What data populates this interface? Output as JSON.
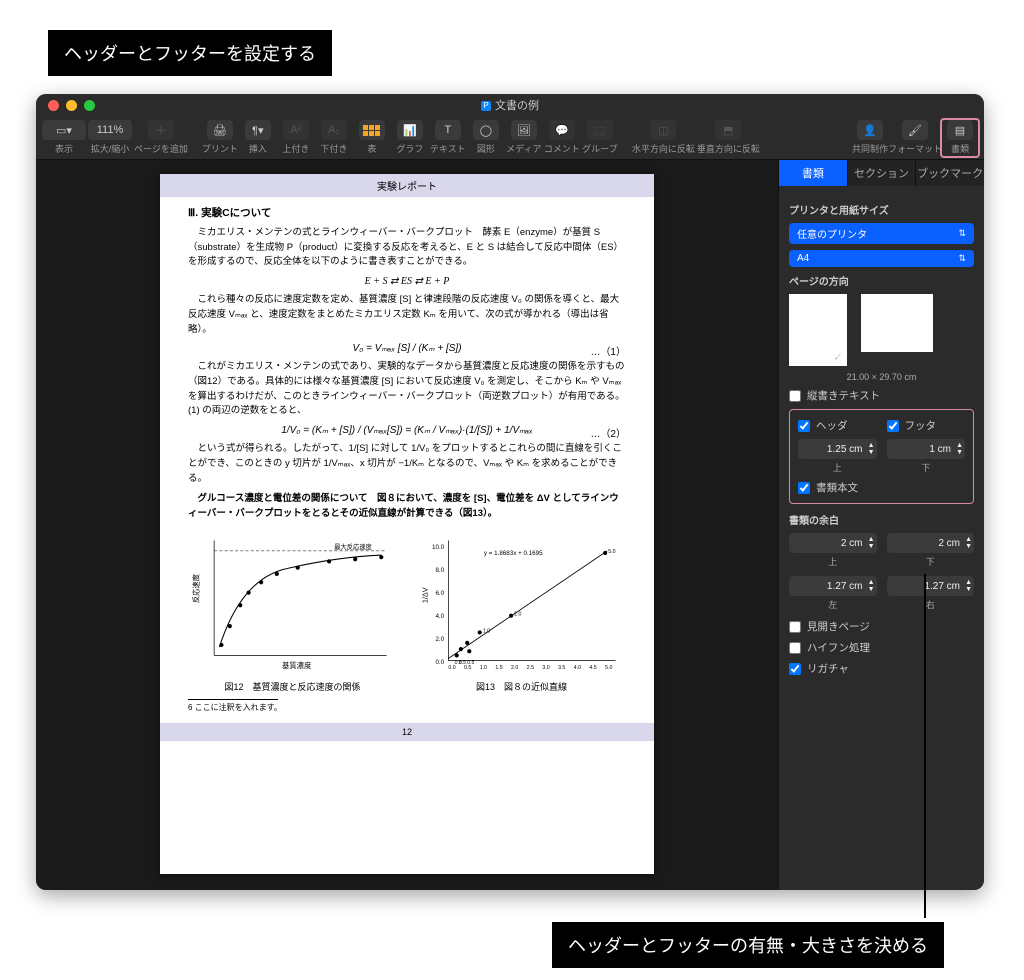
{
  "annotations": {
    "top": "ヘッダーとフッターを設定する",
    "bottom": "ヘッダーとフッターの有無・大きさを決める"
  },
  "window": {
    "title": "文書の例"
  },
  "toolbar": {
    "view": "表示",
    "zoom": "拡大/縮小",
    "zoom_value": "111%",
    "add_page": "ページを追加",
    "print": "プリント",
    "insert": "挿入",
    "superscript": "上付き",
    "subscript": "下付き",
    "table": "表",
    "chart": "グラフ",
    "text": "テキスト",
    "shape": "図形",
    "media": "メディア",
    "comment": "コメント",
    "group": "グループ",
    "flip_h": "水平方向に反転",
    "flip_v": "垂直方向に反転",
    "collab": "共同制作",
    "format": "フォーマット",
    "document": "書類"
  },
  "tabs": {
    "document": "書類",
    "section": "セクション",
    "bookmark": "ブックマーク"
  },
  "inspector": {
    "printer_title": "プリンタと用紙サイズ",
    "printer": "任意のプリンタ",
    "paper": "A4",
    "orientation_title": "ページの方向",
    "dimensions": "21.00 × 29.70 cm",
    "vertical_text": "縦書きテキスト",
    "header": "ヘッダ",
    "footer": "フッタ",
    "header_val": "1.25 cm",
    "footer_val": "1 cm",
    "top_lbl": "上",
    "bottom_lbl": "下",
    "body_text": "書類本文",
    "margins_title": "書類の余白",
    "m_top": "2 cm",
    "m_top_lbl": "上",
    "m_bottom": "2 cm",
    "m_bottom_lbl": "下",
    "m_left": "1.27 cm",
    "m_left_lbl": "左",
    "m_right": "1.27 cm",
    "m_right_lbl": "右",
    "facing": "見開きページ",
    "hyphen": "ハイフン処理",
    "ligature": "リガチャ"
  },
  "doc": {
    "header": "実験レポート",
    "h3": "Ⅲ. 実験Cについて",
    "p1": "ミカエリス・メンテンの式とラインウィーバー・バークプロット　酵素 E（enzyme）が基質 S（substrate）を生成物 P（product）に変換する反応を考えると、E と S は結合して反応中間体（ES）を形成するので、反応全体を以下のように書き表すことができる。",
    "eq1": "E + S ⇄ ES ⇄ E + P",
    "p2": "これら種々の反応に速度定数を定め、基質濃度 [S] と律速段階の反応速度 V₀ の関係を導くと、最大反応速度 Vₘₐₓ と、速度定数をまとめたミカエリス定数 Kₘ を用いて、次の式が導かれる（導出は省略）。",
    "eq2": "V₀ = Vₘₐₓ [S] / (Kₘ + [S])",
    "eq2n": "…（1）",
    "p3": "これがミカエリス・メンテンの式であり、実験的なデータから基質濃度と反応速度の関係を示すもの（図12）である。具体的には様々な基質濃度 [S] において反応速度 V₀ を測定し、そこから Kₘ や Vₘₐₓ を算出するわけだが、このときラインウィーバー・バークプロット（両逆数プロット）が有用である。(1) の両辺の逆数をとると、",
    "eq3": "1/V₀ = (Kₘ + [S]) / (Vₘₐₓ[S]) = (Kₘ / Vₘₐₓ)·(1/[S]) + 1/Vₘₐₓ",
    "eq3n": "…（2）",
    "p4": "という式が得られる。したがって、1/[S] に対して 1/V₀ をプロットするとこれらの間に直線を引くことができ、このときの y 切片が 1/Vₘₐₓ、x 切片が −1/Kₘ となるので、Vₘₐₓ や Kₘ を求めることができる。",
    "p5": "グルコース濃度と電位差の関係について　図８において、濃度を [S]、電位差を ΔV としてラインウィーバー・バークプロットをとるとその近似直線が計算できる（図13）。",
    "regress": "y = 1.8683x + 0.1695",
    "fig12": "図12　基質濃度と反応速度の関係",
    "fig12_y": "反応速度",
    "fig12_x": "基質濃度",
    "fig12_note": "最大反応速度",
    "fig13": "図13　図８の近似直線",
    "fig13_y": "1/ΔV",
    "footnote": "6 ここに注釈を入れます。",
    "page_num": "12"
  },
  "chart_data": [
    {
      "type": "scatter",
      "id": "fig12",
      "title": "図12 基質濃度と反応速度の関係",
      "xlabel": "基質濃度",
      "ylabel": "反応速度",
      "annotations": [
        "最大反応速度"
      ],
      "x": [
        0.3,
        0.6,
        1.0,
        1.3,
        1.8,
        2.5,
        3.4,
        5.0,
        7.0,
        9.0
      ],
      "y": [
        0.8,
        1.8,
        2.6,
        3.0,
        3.3,
        3.6,
        3.8,
        3.9,
        4.0,
        4.0
      ],
      "asymptote_y": 4.2
    },
    {
      "type": "scatter",
      "id": "fig13",
      "title": "図13 図８の近似直線",
      "xlabel": "",
      "ylabel": "1/ΔV",
      "xlim": [
        0.0,
        5.0
      ],
      "ylim": [
        0.0,
        10.0
      ],
      "xticks": [
        0.0,
        0.5,
        1.0,
        1.5,
        2.0,
        2.5,
        3.0,
        3.5,
        4.0,
        4.5,
        5.0
      ],
      "yticks": [
        0.0,
        2.0,
        4.0,
        6.0,
        8.0,
        10.0
      ],
      "regression": "y = 1.8683x + 0.1695",
      "points": [
        {
          "x": 0.3,
          "y": 0.3,
          "label": "0.5"
        },
        {
          "x": 0.5,
          "y": 0.7,
          "label": "0.5"
        },
        {
          "x": 0.6,
          "y": 1.1
        },
        {
          "x": 0.7,
          "y": 0.6,
          "label": "0.5"
        },
        {
          "x": 1.0,
          "y": 2.6,
          "label": "1.0"
        },
        {
          "x": 2.0,
          "y": 3.9,
          "label": "2.0"
        },
        {
          "x": 5.0,
          "y": 9.5,
          "label": "5.0"
        }
      ]
    }
  ]
}
